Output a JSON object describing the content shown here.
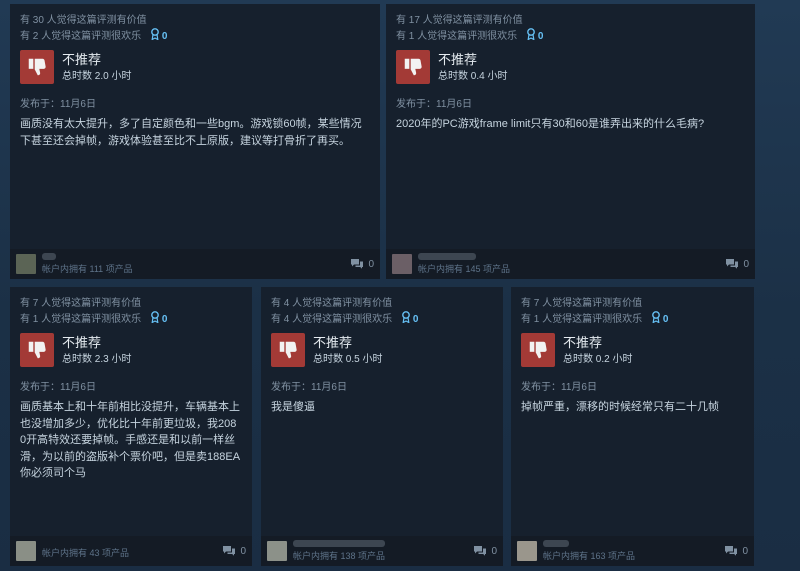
{
  "colors": {
    "accent": "#66c0f4",
    "negative": "#a33a36",
    "card_bg": "#16202d",
    "footer_bg": "#141b25"
  },
  "icons": {
    "thumb": "thumbs-down-icon",
    "award": "award-ribbon-icon",
    "comment": "comment-bubble-icon"
  },
  "reviews": [
    {
      "helpful": "有 30 人觉得这篇评测有价值",
      "funny": "有 2 人觉得这篇评测很欢乐",
      "award_count": "0",
      "verdict": "不推荐",
      "hours": "总时数 2.0 小时",
      "posted": "发布于：11月6日",
      "text": "画质没有太大提升，多了自定颜色和一些bgm。游戏锁60帧，某些情况下甚至还会掉帧，游戏体验甚至比不上原版，建议等打骨折了再买。",
      "products": "帐户内拥有 111 项产品",
      "comments": "0"
    },
    {
      "helpful": "有 17 人觉得这篇评测有价值",
      "funny": "有 1 人觉得这篇评测很欢乐",
      "award_count": "0",
      "verdict": "不推荐",
      "hours": "总时数 0.4 小时",
      "posted": "发布于：11月6日",
      "text": "2020年的PC游戏frame limit只有30和60是谁弄出来的什么毛病?",
      "products": "帐户内拥有 145 项产品",
      "comments": "0"
    },
    {
      "helpful": "有 7 人觉得这篇评测有价值",
      "funny": "有 1 人觉得这篇评测很欢乐",
      "award_count": "0",
      "verdict": "不推荐",
      "hours": "总时数 2.3 小时",
      "posted": "发布于：11月6日",
      "text": "画质基本上和十年前相比没提升，车辆基本上也没增加多少，优化比十年前更垃圾，我2080开高特效还要掉帧。手感还是和以前一样丝滑，为以前的盗版补个票价吧，但是卖188EA你必须司个马",
      "products": "帐户内拥有 43 项产品",
      "comments": "0"
    },
    {
      "helpful": "有 4 人觉得这篇评测有价值",
      "funny": "有 4 人觉得这篇评测很欢乐",
      "award_count": "0",
      "verdict": "不推荐",
      "hours": "总时数 0.5 小时",
      "posted": "发布于：11月6日",
      "text": "我是傻逼",
      "products": "帐户内拥有 138 项产品",
      "comments": "0"
    },
    {
      "helpful": "有 7 人觉得这篇评测有价值",
      "funny": "有 1 人觉得这篇评测很欢乐",
      "award_count": "0",
      "verdict": "不推荐",
      "hours": "总时数 0.2 小时",
      "posted": "发布于：11月6日",
      "text": "掉帧严重，漂移的时候经常只有二十几帧",
      "products": "帐户内拥有 163 项产品",
      "comments": "0"
    }
  ]
}
